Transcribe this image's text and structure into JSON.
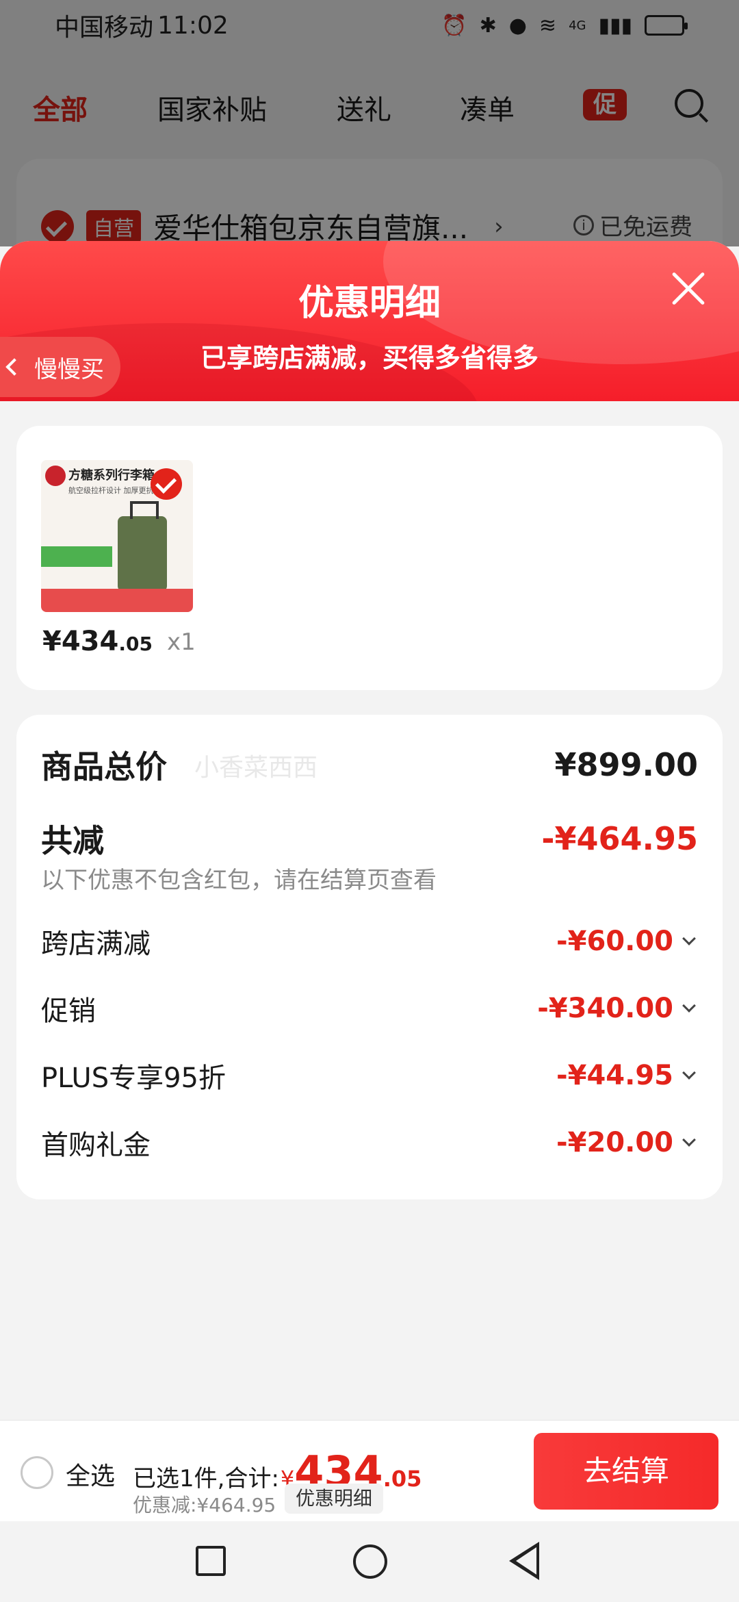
{
  "status_bar": {
    "carrier": "中国移动",
    "time": "11:02",
    "network": "4G"
  },
  "top_nav": {
    "tabs": [
      "全部",
      "国家补贴",
      "送礼",
      "凑单"
    ],
    "promo_label": "促"
  },
  "store": {
    "badge": "自营",
    "name": "爱华仕箱包京东自营旗...",
    "shipping": "已免运费"
  },
  "sheet": {
    "title": "优惠明细",
    "subtitle": "已享跨店满减，买得多省得多",
    "product": {
      "image_title": "方糖系列行李箱",
      "image_subtitle": "航空级拉杆设计 加厚更抗压",
      "slow_buy": "慢慢买",
      "price_int": "¥434",
      "price_dec": ".05",
      "qty": "x1"
    },
    "watermark": "小香菜西西",
    "total": {
      "label": "商品总价",
      "amount": "¥899.00"
    },
    "reduction": {
      "label": "共减",
      "amount": "-¥464.95",
      "note": "以下优惠不包含红包，请在结算页查看"
    },
    "items": [
      {
        "label": "跨店满减",
        "amount": "-¥60.00"
      },
      {
        "label": "促销",
        "amount": "-¥340.00"
      },
      {
        "label": "PLUS专享95折",
        "amount": "-¥44.95"
      },
      {
        "label": "首购礼金",
        "amount": "-¥20.00"
      }
    ]
  },
  "bottom_bar": {
    "select_all": "全选",
    "selected_text": "已选1件,合计:",
    "yen": "¥",
    "price_big": "434",
    "price_small": ".05",
    "discount": "优惠减:¥464.95",
    "discount_btn": "优惠明细",
    "checkout": "去结算"
  },
  "colors": {
    "accent": "#e2231a",
    "header_gradient_top": "#ff4a4a",
    "header_gradient_bottom": "#f51e2a"
  }
}
